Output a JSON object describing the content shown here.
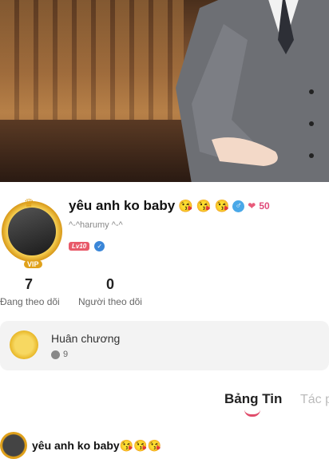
{
  "profile": {
    "display_name": "yêu anh ko baby",
    "name_emojis": [
      "😘",
      "😘",
      "😘"
    ],
    "gender_symbol": "♂",
    "points_icon": "heart-pair-icon",
    "points": "50",
    "username": "^-^harumy ^-^",
    "level_badge": "Lv10",
    "verified_icon": "shield-icon",
    "vip_label": "VIP"
  },
  "stats": [
    {
      "value": "7",
      "label": "Đang theo dõi"
    },
    {
      "value": "0",
      "label": "Người theo dõi"
    }
  ],
  "medals": {
    "title": "Huân chương",
    "count": "9"
  },
  "tabs": [
    {
      "label": "Bảng Tin",
      "active": true
    },
    {
      "label": "Tác p",
      "active": false
    }
  ],
  "post": {
    "author": "yêu anh ko baby😘😘😘"
  },
  "colors": {
    "accent": "#e04b6a",
    "gold": "#e0a11b",
    "level_badge": "#e85a6a"
  }
}
